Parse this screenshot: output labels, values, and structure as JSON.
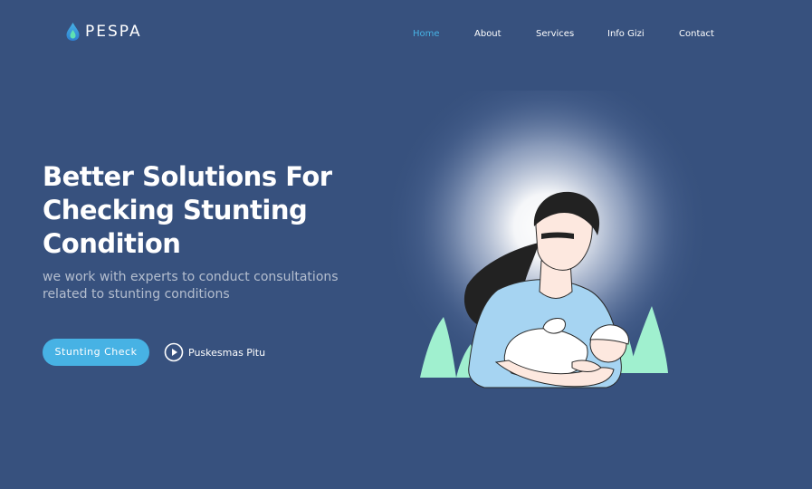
{
  "brand": {
    "name": "PESPA",
    "icon": "water-drop-icon"
  },
  "nav": {
    "items": [
      {
        "label": "Home",
        "active": true
      },
      {
        "label": "About",
        "active": false
      },
      {
        "label": "Services",
        "active": false
      },
      {
        "label": "Info Gizi",
        "active": false
      },
      {
        "label": "Contact",
        "active": false
      }
    ]
  },
  "hero": {
    "title": "Better Solutions For Checking Stunting Condition",
    "subtitle": "we work with experts to conduct consultations related to stunting conditions",
    "cta_label": "Stunting Check",
    "video_label": "Puskesmas Pitu",
    "video_icon": "play-circle-icon",
    "illustration": "mother-breastfeeding-illustration"
  },
  "colors": {
    "background": "#37517e",
    "accent": "#47b2e4",
    "text": "#ffffff",
    "plant": "#a0f0cf",
    "shirt": "#a6d4f2"
  }
}
